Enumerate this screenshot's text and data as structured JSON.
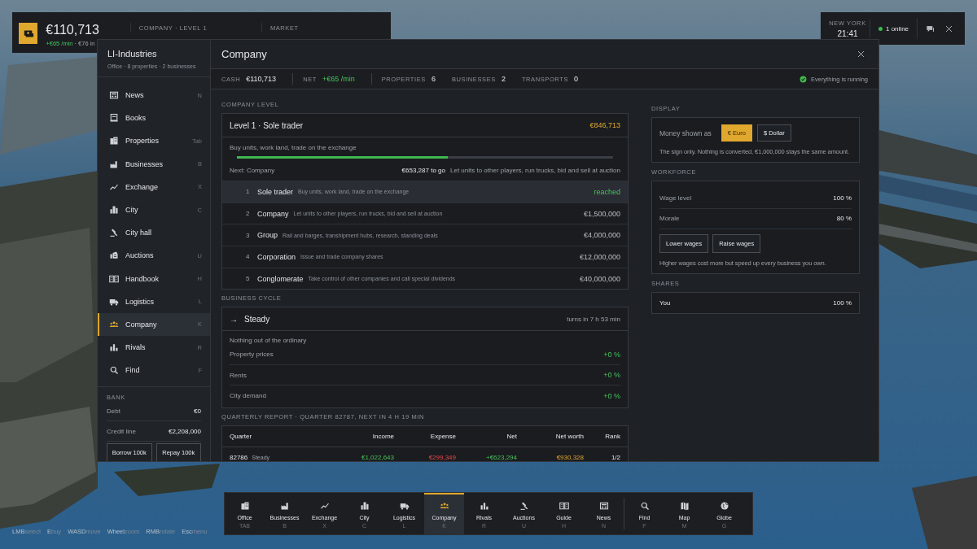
{
  "hud": {
    "cash": "€110,713",
    "rate": "+€65 /min",
    "income": "· €76 in",
    "columns": [
      {
        "label": "COMPANY · LEVEL 1"
      },
      {
        "label": "MARKET"
      }
    ]
  },
  "status": {
    "city": "NEW YORK",
    "time": "21:41",
    "online": "1 online"
  },
  "sidebar": {
    "company": "LI-Industries",
    "summary": "Office · 8 properties · 2 businesses",
    "items": [
      {
        "label": "News",
        "key": "N",
        "selected": false
      },
      {
        "label": "Books",
        "selected": false
      },
      {
        "label": "Properties",
        "key": "Tab",
        "selected": false
      },
      {
        "label": "Businesses",
        "key": "B",
        "selected": false
      },
      {
        "label": "Exchange",
        "key": "X",
        "selected": false
      },
      {
        "label": "City",
        "key": "C",
        "selected": false
      },
      {
        "label": "City hall",
        "selected": false
      },
      {
        "label": "Auctions",
        "key": "U",
        "selected": false
      },
      {
        "label": "Handbook",
        "key": "H",
        "selected": false
      },
      {
        "label": "Logistics",
        "key": "L",
        "selected": false
      },
      {
        "label": "Company",
        "key": "K",
        "selected": true
      },
      {
        "label": "Rivals",
        "key": "R",
        "selected": false
      },
      {
        "label": "Find",
        "key": "F",
        "selected": false
      }
    ],
    "bank": {
      "title": "BANK",
      "rows": [
        {
          "label": "Debt",
          "value": "€0"
        },
        {
          "label": "Credit line",
          "value": "€2,208,000"
        }
      ],
      "buttons": [
        "Borrow 100k",
        "Repay 100k"
      ]
    }
  },
  "window": {
    "title": "Company"
  },
  "stats": [
    {
      "label": "CASH",
      "value": "€110,713",
      "kind": "plain",
      "divider": true
    },
    {
      "label": "NET",
      "value": "+€65 /min",
      "kind": "good",
      "divider": true
    },
    {
      "label": "PROPERTIES",
      "value": "6",
      "kind": "plain",
      "divider": false
    },
    {
      "label": "BUSINESSES",
      "value": "2",
      "kind": "plain",
      "divider": false
    },
    {
      "label": "TRANSPORTS",
      "value": "0",
      "kind": "plain",
      "divider": false
    }
  ],
  "running": "Everything is running",
  "company_level": {
    "heading": "COMPANY LEVEL",
    "title": "Level 1 · Sole trader",
    "worth": "€846,713",
    "perks": "Buy units, work land, trade on the exchange",
    "level": 0.56,
    "next": "Next: Company",
    "to_go": "€653,287 to go",
    "next_perks": "Let units to other players, run trucks, bid and sell at auction",
    "levels": [
      {
        "num": "1",
        "name": "Sole trader",
        "desc": "Buy units, work land, trade on the exchange",
        "value": "reached",
        "reached": true
      },
      {
        "num": "2",
        "name": "Company",
        "desc": "Let units to other players, run trucks, bid and sell at auction",
        "value": "€1,500,000",
        "reached": false
      },
      {
        "num": "3",
        "name": "Group",
        "desc": "Rail and barges, transhipment hubs, research, standing deals",
        "value": "€4,000,000",
        "reached": false
      },
      {
        "num": "4",
        "name": "Corporation",
        "desc": "Issue and trade company shares",
        "value": "€12,000,000",
        "reached": false
      },
      {
        "num": "5",
        "name": "Conglomerate",
        "desc": "Take control of other companies and call special dividends",
        "value": "€40,000,000",
        "reached": false
      }
    ]
  },
  "business_cycle": {
    "heading": "BUSINESS CYCLE",
    "arrow": "→",
    "phase": "Steady",
    "turns": "turns in 7 h 53 min",
    "note": "Nothing out of the ordinary",
    "rows": [
      {
        "label": "Property prices",
        "value": "+0 %"
      },
      {
        "label": "Rents",
        "value": "+0 %"
      },
      {
        "label": "City demand",
        "value": "+0 %"
      }
    ]
  },
  "quarterly": {
    "heading": "QUARTERLY REPORT · QUARTER 82787, NEXT IN 4 H 19 MIN",
    "columns": [
      "Quarter",
      "Income",
      "Expense",
      "Net",
      "Net worth",
      "Rank"
    ],
    "rows": [
      {
        "quarter": "82786",
        "phase": "Steady",
        "income": "€1,022,643",
        "expense": "€299,349",
        "net": "+€623,294",
        "worth": "€930,328",
        "rank": "1/2"
      }
    ]
  },
  "display": {
    "heading": "DISPLAY",
    "label": "Money shown as",
    "options": [
      {
        "label": "€ Euro",
        "selected": true
      },
      {
        "label": "$ Dollar",
        "selected": false
      }
    ],
    "note": "The sign only. Nothing is converted, €1,000,000 stays the same amount."
  },
  "workforce": {
    "heading": "WORKFORCE",
    "rows": [
      {
        "label": "Wage level",
        "value": "100 %"
      },
      {
        "label": "Morale",
        "value": "80 %"
      }
    ],
    "buttons": [
      "Lower wages",
      "Raise wages"
    ],
    "note": "Higher wages cost more but speed up every business you own."
  },
  "shares": {
    "heading": "SHARES",
    "rows": [
      {
        "label": "You",
        "value": "100 %"
      }
    ]
  },
  "toolbar": [
    {
      "kind": "button",
      "label": "Office",
      "key": "TAB",
      "selected": false
    },
    {
      "kind": "button",
      "label": "Businesses",
      "key": "B",
      "selected": false
    },
    {
      "kind": "button",
      "label": "Exchange",
      "key": "X",
      "selected": false
    },
    {
      "kind": "button",
      "label": "City",
      "key": "C",
      "selected": false
    },
    {
      "kind": "button",
      "label": "Logistics",
      "key": "L",
      "selected": false
    },
    {
      "kind": "button",
      "label": "Company",
      "key": "K",
      "selected": true
    },
    {
      "kind": "button",
      "label": "Rivals",
      "key": "R",
      "selected": false
    },
    {
      "kind": "button",
      "label": "Auctions",
      "key": "U",
      "selected": false
    },
    {
      "kind": "button",
      "label": "Guide",
      "key": "H",
      "selected": false
    },
    {
      "kind": "button",
      "label": "News",
      "key": "N",
      "selected": false
    },
    {
      "kind": "separator"
    },
    {
      "kind": "button",
      "label": "Find",
      "key": "F",
      "selected": false
    },
    {
      "kind": "button",
      "label": "Map",
      "key": "M",
      "selected": false
    },
    {
      "kind": "button",
      "label": "Globe",
      "key": "G",
      "selected": false
    }
  ],
  "hints": [
    {
      "key": "LMB",
      "action": "select"
    },
    {
      "key": "E",
      "action": "buy"
    },
    {
      "key": "WASD",
      "action": "move"
    },
    {
      "key": "Wheel",
      "action": "zoom"
    },
    {
      "key": "RMB",
      "action": "rotate"
    },
    {
      "key": "Esc",
      "action": "menu"
    }
  ]
}
